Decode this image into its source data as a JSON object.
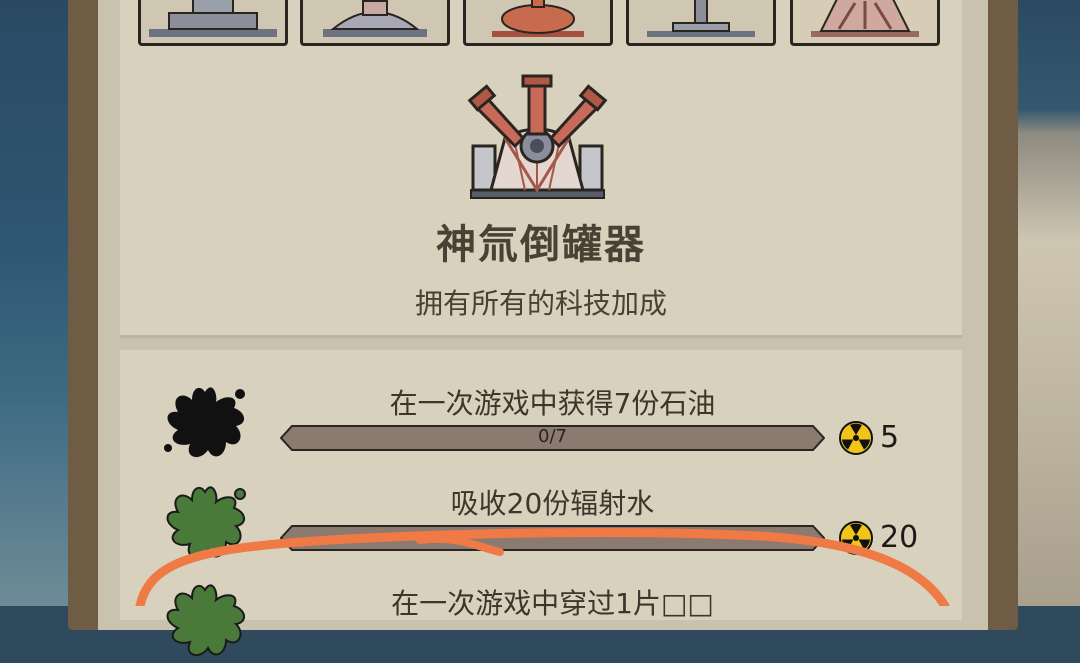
{
  "item": {
    "title": "神氚倒罐器",
    "description": "拥有所有的科技加成"
  },
  "tasks": [
    {
      "label": "在一次游戏中获得7份石油",
      "progress_text": "0/7",
      "progress": 0.0,
      "reward": "5",
      "icon": "oil-splat-icon",
      "color": "#111111"
    },
    {
      "label": "吸收20份辐射水",
      "progress_text": "",
      "progress": 0.0,
      "reward": "20",
      "icon": "radioactive-splat-icon",
      "color": "#4a7a3a"
    },
    {
      "label": "在一次游戏中穿过1片□□",
      "progress_text": "",
      "progress": 0.0,
      "reward": "",
      "icon": "green-splat-icon",
      "color": "#4a7a3a"
    }
  ],
  "colors": {
    "panel": "#d8d1bd",
    "frame": "#6e5c44",
    "bar": "#8a7a70",
    "annotation": "#ef7a45",
    "radiation": "#f2c417"
  },
  "icons": {
    "currency": "radiation-icon",
    "thumbnails": [
      "machine-thumb-1",
      "machine-thumb-2",
      "machine-thumb-3",
      "machine-thumb-4",
      "machine-thumb-5"
    ],
    "main": "tank-pourer-icon"
  }
}
